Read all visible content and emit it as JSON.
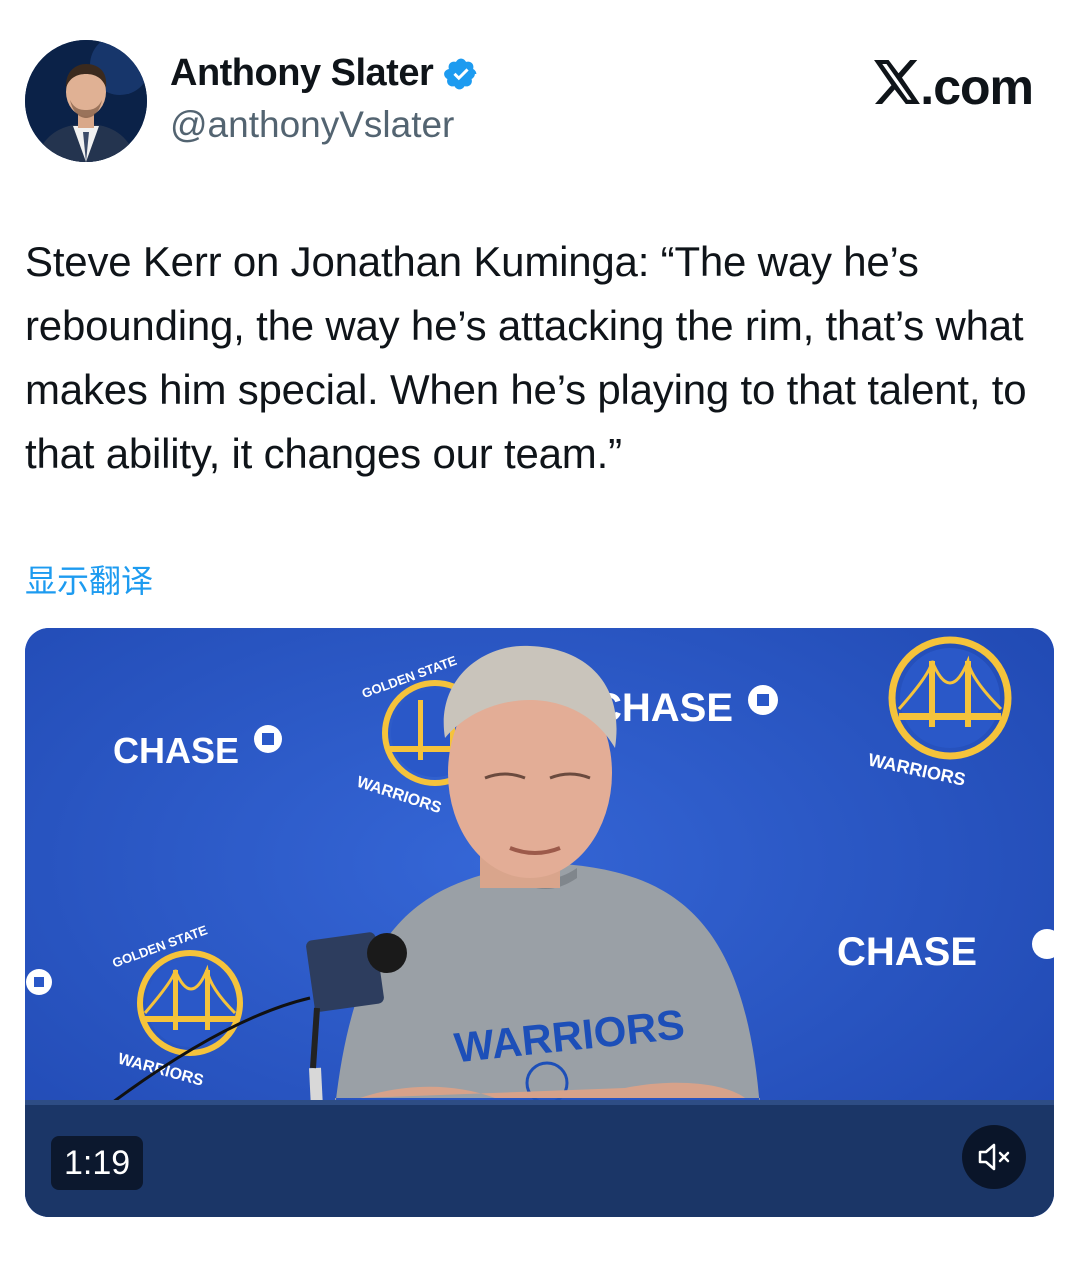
{
  "author": {
    "display_name": "Anthony Slater",
    "handle": "@anthonyVslater",
    "verified_icon": "verified-badge-icon",
    "avatar_icon": "profile-photo"
  },
  "brand": {
    "label": ".com",
    "icon": "x-logo-icon"
  },
  "tweet": {
    "text": "Steve Kerr on Jonathan Kuminga: “The way he’s rebounding, the way he’s attacking the rim, that’s what makes him special. When he’s playing to that talent, to that ability, it changes our team.”",
    "translate_label": "显示翻译"
  },
  "video": {
    "duration": "1:19",
    "mute_icon": "volume-muted-icon",
    "backdrop": {
      "sponsor_text": "CHASE",
      "team_logo_top": "GOLDEN STATE",
      "team_logo_bottom": "WARRIORS",
      "shirt_text": "WARRIORS"
    }
  },
  "colors": {
    "link_blue": "#1d9bf0",
    "verified_blue": "#1d9bf0",
    "backdrop_blue": "#2a58c8",
    "warriors_gold": "#f5c33b",
    "text_primary": "#0f1419",
    "text_secondary": "#536471"
  }
}
